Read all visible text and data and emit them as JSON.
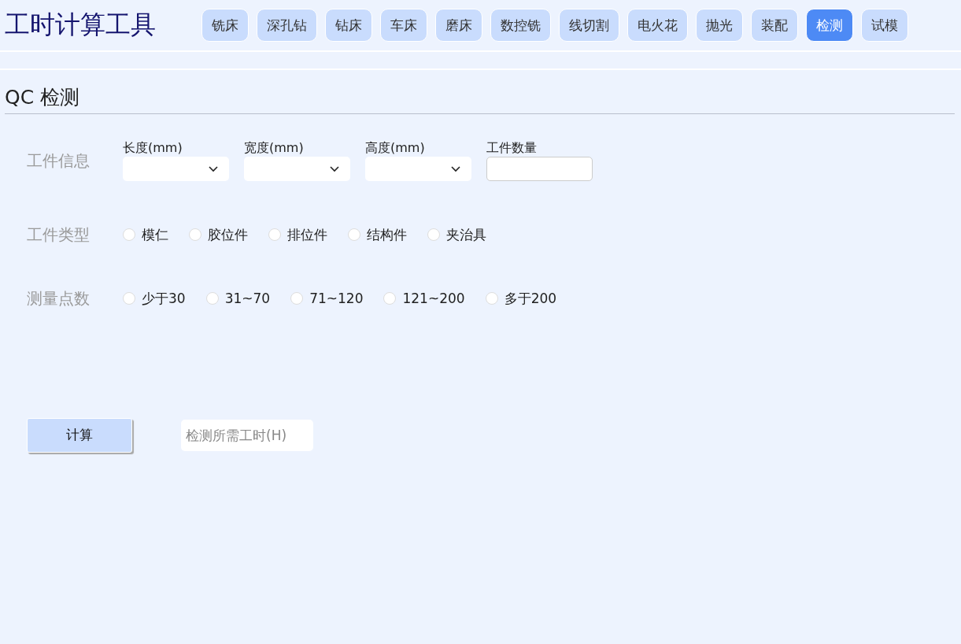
{
  "app_title": "工时计算工具",
  "tabs": [
    {
      "label": "铣床",
      "selected": false
    },
    {
      "label": "深孔钻",
      "selected": false
    },
    {
      "label": "钻床",
      "selected": false
    },
    {
      "label": "车床",
      "selected": false
    },
    {
      "label": "磨床",
      "selected": false
    },
    {
      "label": "数控铣",
      "selected": false
    },
    {
      "label": "线切割",
      "selected": false
    },
    {
      "label": "电火花",
      "selected": false
    },
    {
      "label": "抛光",
      "selected": false
    },
    {
      "label": "装配",
      "selected": false
    },
    {
      "label": "检测",
      "selected": true
    },
    {
      "label": "试模",
      "selected": false
    }
  ],
  "section_title": "QC 检测",
  "workpiece_info": {
    "label": "工件信息",
    "fields": [
      {
        "label": "长度(mm)",
        "kind": "select"
      },
      {
        "label": "宽度(mm)",
        "kind": "select"
      },
      {
        "label": "高度(mm)",
        "kind": "select"
      },
      {
        "label": "工件数量",
        "kind": "input"
      }
    ]
  },
  "workpiece_type": {
    "label": "工件类型",
    "options": [
      {
        "label": "模仁",
        "selected": false
      },
      {
        "label": "胶位件",
        "selected": false
      },
      {
        "label": "排位件",
        "selected": false
      },
      {
        "label": "结构件",
        "selected": false
      },
      {
        "label": "夹治具",
        "selected": false
      }
    ]
  },
  "measure_points": {
    "label": "测量点数",
    "options": [
      {
        "label": "少于30",
        "selected": false
      },
      {
        "label": "31~70",
        "selected": false
      },
      {
        "label": "71~120",
        "selected": false
      },
      {
        "label": "121~200",
        "selected": false
      },
      {
        "label": "多于200",
        "selected": false
      }
    ]
  },
  "calculate_button": "计算",
  "result": {
    "placeholder": "检测所需工时(H)"
  }
}
